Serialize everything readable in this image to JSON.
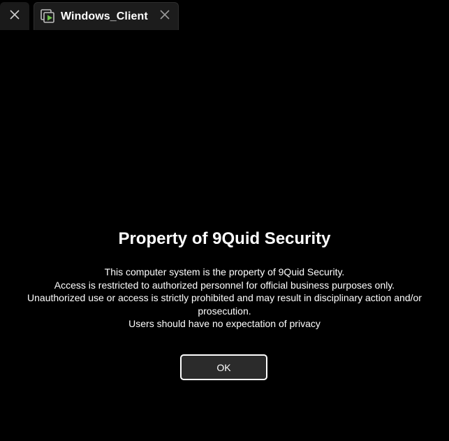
{
  "tabs": [
    {
      "label": "",
      "icon": "close-icon"
    },
    {
      "label": "Windows_Client",
      "icon": "remote-session-icon",
      "close_icon": "close-icon"
    }
  ],
  "dialog": {
    "title": "Property of 9Quid Security",
    "message_lines": [
      "This computer system is the property of 9Quid Security.",
      "Access is restricted to authorized personnel for official business purposes only.",
      "Unauthorized use or access is strictly prohibited and may result in disciplinary action and/or prosecution.",
      "Users should have no expectation of privacy"
    ],
    "ok_label": "OK"
  },
  "colors": {
    "background": "#000000",
    "tab_active_bg": "#1c1c1c",
    "accent_green": "#6cc24a",
    "text": "#ffffff"
  }
}
